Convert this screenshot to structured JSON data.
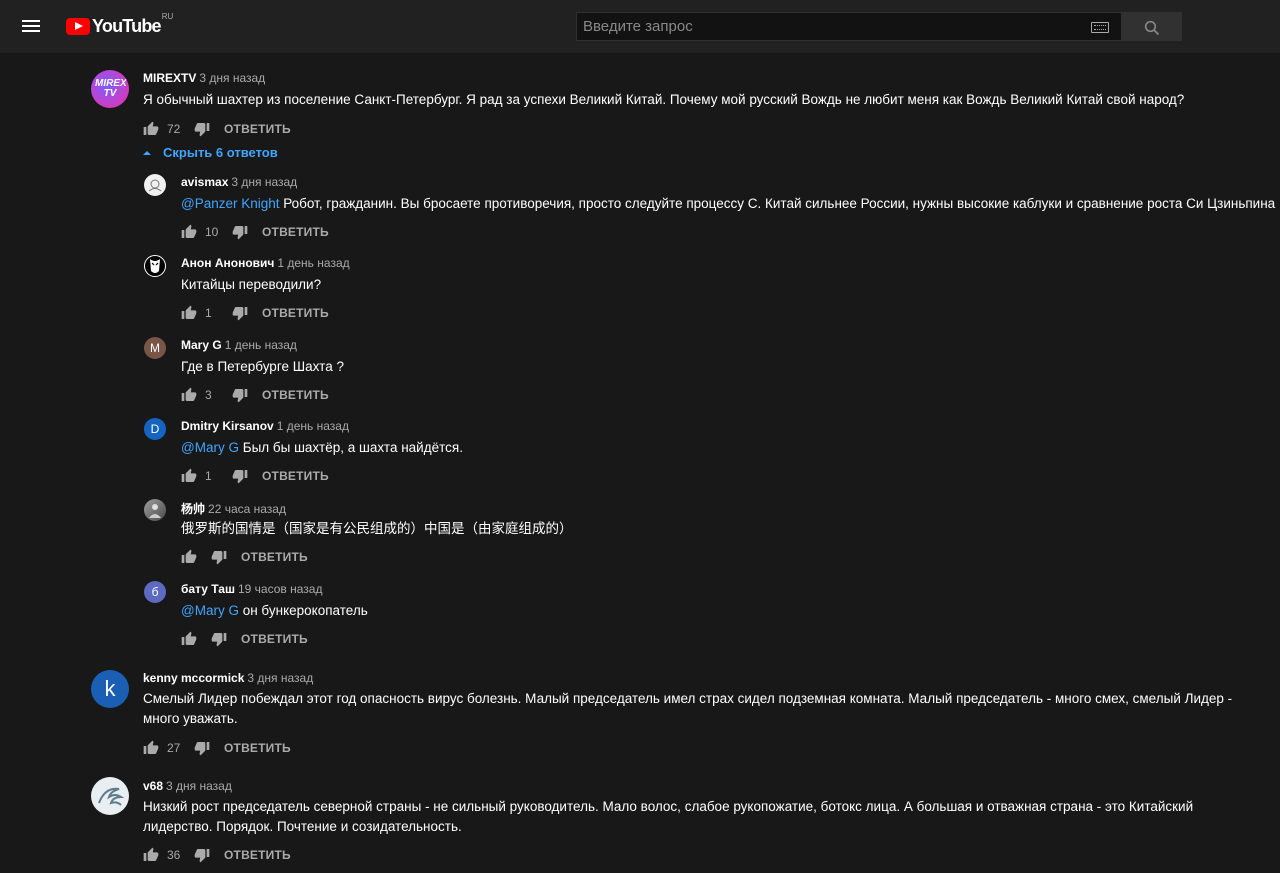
{
  "header": {
    "brand": "YouTube",
    "region": "RU",
    "search_placeholder": "Введите запрос",
    "ghost_lines": [
      "",
      ""
    ]
  },
  "comments": [
    {
      "author": "MIREXTV",
      "time": "3 дня назад",
      "text": "Я обычный шахтер из поселение Санкт-Петербург.  Я рад за успехи Великий Китай. Почему мой русский Вождь не любит меня как Вождь Великий Китай свой народ?",
      "likes": "72",
      "reply": "ОТВЕТИТЬ",
      "avatar_text": "MIREX TV"
    },
    {
      "author": "kenny mccormick",
      "time": "3 дня назад",
      "text": "Смелый Лидер побеждал этот год опасность вирус болезнь. Малый председатель имел страх сидел подземная комната. Малый председатель - много смех, смелый Лидер - много уважать.",
      "likes": "27",
      "reply": "ОТВЕТИТЬ",
      "avatar_text": "k"
    },
    {
      "author": "v68",
      "time": "3 дня назад",
      "text": "Низкий рост председатель северной страны - не сильный руководитель. Мало волос, слабое рукопожатие, ботокс лица. А большая и отважная страна  - это Китайский лидерство. Порядок. Почтение и созидательность.",
      "likes": "36",
      "reply": "ОТВЕТИТЬ"
    }
  ],
  "replies_toggle": "Скрыть 6 ответов",
  "replies": [
    {
      "author": "avismax",
      "time": "3 дня назад",
      "mention": "@Panzer Knight",
      "text": " Робот, гражданин. Вы бросаете противоречия, просто следуйте процессу С. Китай сильнее России, нужны высокие каблуки и сравнение роста Си Цзиньпина",
      "likes": "10",
      "reply": "ОТВЕТИТЬ"
    },
    {
      "author": "Анон Анонович",
      "time": "1 день назад",
      "mention": "",
      "text": "Китайцы переводили?",
      "likes": "1",
      "reply": "ОТВЕТИТЬ"
    },
    {
      "author": "Mary G",
      "time": "1 день назад",
      "mention": "",
      "text": "Где в Петербурге Шахта ?",
      "likes": "3",
      "reply": "ОТВЕТИТЬ",
      "avatar_text": "M"
    },
    {
      "author": "Dmitry Kirsanov",
      "time": "1 день назад",
      "mention": "@Mary G",
      "text": " Был бы шахтёр, а шахта найдётся.",
      "likes": "1",
      "reply": "ОТВЕТИТЬ",
      "avatar_text": "D"
    },
    {
      "author": "杨帅",
      "time": "22 часа назад",
      "mention": "",
      "text": "俄罗斯的国情是（国家是有公民组成的）中国是（由家庭组成的）",
      "likes": "",
      "reply": "ОТВЕТИТЬ"
    },
    {
      "author": "бату Таш",
      "time": "19 часов назад",
      "mention": "@Mary G",
      "text": " он бункерокопатель",
      "likes": "",
      "reply": "ОТВЕТИТЬ",
      "avatar_text": "б"
    }
  ],
  "colors": {
    "background": "#181818",
    "header": "#212121",
    "link": "#3ea6ff",
    "brand_red": "#ff0000"
  }
}
